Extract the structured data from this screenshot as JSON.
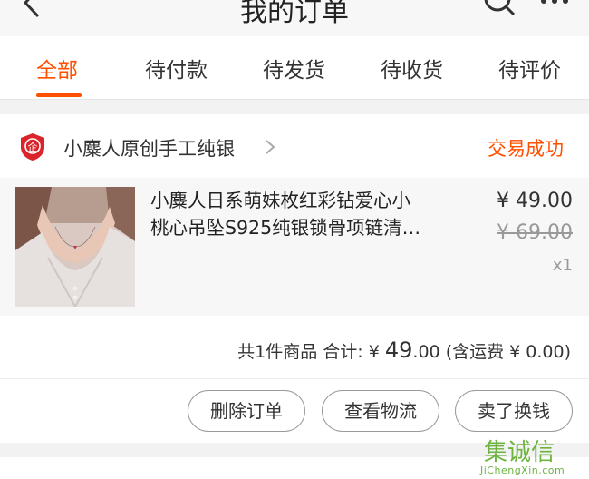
{
  "nav": {
    "title": "我的订单",
    "back_icon": "back-chevron-icon",
    "search_icon": "search-icon",
    "more_icon": "more-dots-icon"
  },
  "tabs": [
    {
      "label": "全部",
      "active": true
    },
    {
      "label": "待付款",
      "active": false
    },
    {
      "label": "待发货",
      "active": false
    },
    {
      "label": "待收货",
      "active": false
    },
    {
      "label": "待评价",
      "active": false
    }
  ],
  "order": {
    "shop": {
      "logo_icon": "shop-shield-logo",
      "logo_char": "企",
      "name": "小麋人原创手工纯银"
    },
    "status": "交易成功",
    "item": {
      "title_line1": "小麋人日系萌妹枚红彩钻爱心小",
      "title_line2": "桃心吊坠S925纯银锁骨项链清…",
      "price": "¥ 49.00",
      "original_price": "¥ 69.00",
      "quantity": "x1"
    },
    "summary": {
      "count_text": "共1件商品 合计:",
      "currency": "¥",
      "total_int": "49",
      "total_dec": ".00",
      "shipping_text": "(含运费 ¥ 0.00)"
    },
    "actions": {
      "delete_label": "删除订单",
      "logistics_label": "查看物流",
      "resell_label": "卖了换钱"
    }
  },
  "watermark": {
    "chars": "集诚信",
    "site": "JiChengXin.com"
  },
  "colors": {
    "accent": "#ff5000",
    "shop_logo": "#d8242a",
    "watermark": "#6db33f"
  }
}
